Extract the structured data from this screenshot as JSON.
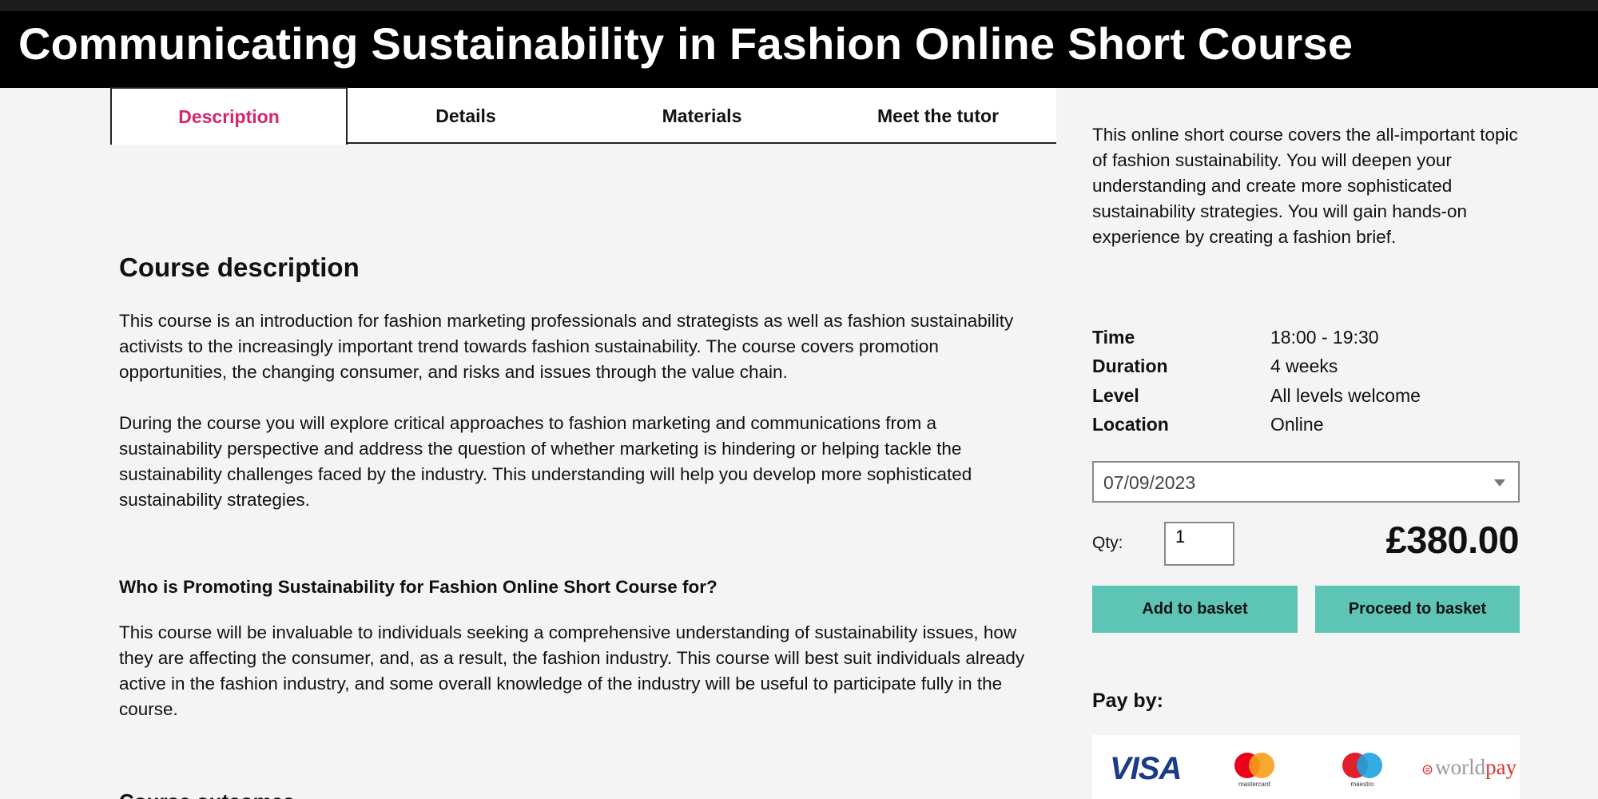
{
  "header": {
    "title": "Communicating Sustainability in Fashion Online Short Course"
  },
  "tabs": [
    {
      "label": "Description",
      "active": true
    },
    {
      "label": "Details"
    },
    {
      "label": "Materials"
    },
    {
      "label": "Meet the tutor"
    }
  ],
  "main": {
    "heading": "Course description",
    "paragraphs": [
      "This course is an introduction for fashion marketing professionals and strategists as well as fashion sustainability activists to the increasingly important trend towards fashion sustainability. The course covers promotion opportunities, the changing consumer, and risks and issues through the value chain.",
      "During the course you will explore critical approaches to fashion marketing and communications from a sustainability perspective and address the question of whether marketing is hindering or helping tackle the sustainability challenges faced by the industry. This understanding will help you develop more sophisticated sustainability strategies."
    ],
    "subheading": "Who is Promoting Sustainability for Fashion Online Short Course for?",
    "paragraph3": "This course will be invaluable to individuals seeking a comprehensive understanding of sustainability issues, how they are affecting the consumer, and, as a result, the fashion industry. This course will best suit individuals already active in the fashion industry, and some overall knowledge of the industry will be useful to participate fully in the course.",
    "cut_heading": "Course outcomes"
  },
  "sidebar": {
    "summary": "This online short course covers the all-important topic of fashion sustainability. You will deepen your understanding and create more sophisticated sustainability strategies. You will gain hands-on experience by creating a fashion brief.",
    "info": [
      {
        "key": "Time",
        "value": "18:00 - 19:30"
      },
      {
        "key": "Duration",
        "value": "4 weeks"
      },
      {
        "key": "Level",
        "value": "All levels welcome"
      },
      {
        "key": "Location",
        "value": "Online"
      }
    ],
    "date_selected": "07/09/2023",
    "qty_label": "Qty:",
    "qty_value": "1",
    "price": "£380.00",
    "add_button": "Add to basket",
    "proceed_button": "Proceed to basket",
    "pay_by": "Pay by:",
    "payment_logos": {
      "visa": "VISA",
      "mastercard": "mastercard",
      "maestro": "maestro",
      "worldpay_a": "world",
      "worldpay_b": "pay"
    }
  },
  "colors": {
    "accent_tab": "#d6246e",
    "button": "#5ec4b6",
    "header_bg": "#000000",
    "page_bg": "#f4f4f4"
  },
  "icons": {
    "dropdown": "chevron-down-icon",
    "mastercard": "mastercard-logo-icon",
    "maestro": "maestro-logo-icon",
    "worldpay": "worldpay-logo-icon"
  }
}
